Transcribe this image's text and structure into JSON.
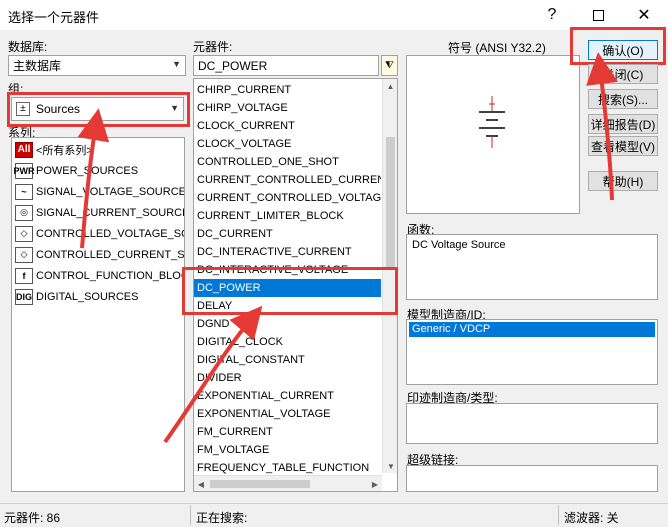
{
  "window": {
    "title": "选择一个元器件"
  },
  "database": {
    "label": "数据库:",
    "value": "主数据库"
  },
  "group": {
    "label": "组:",
    "value": "Sources"
  },
  "series": {
    "label": "系列:",
    "items": [
      {
        "icon": "All",
        "label": "<所有系列>"
      },
      {
        "icon": "PWR",
        "label": "POWER_SOURCES"
      },
      {
        "icon": "~",
        "label": "SIGNAL_VOLTAGE_SOURCES"
      },
      {
        "icon": "◎",
        "label": "SIGNAL_CURRENT_SOURCES"
      },
      {
        "icon": "◇",
        "label": "CONTROLLED_VOLTAGE_SOUR"
      },
      {
        "icon": "◇",
        "label": "CONTROLLED_CURRENT_SOUI"
      },
      {
        "icon": "f",
        "label": "CONTROL_FUNCTION_BLOCKS"
      },
      {
        "icon": "DIG",
        "label": "DIGITAL_SOURCES"
      }
    ]
  },
  "component": {
    "label": "元器件:",
    "search_value": "DC_POWER",
    "items": [
      "CHIRP_CURRENT",
      "CHIRP_VOLTAGE",
      "CLOCK_CURRENT",
      "CLOCK_VOLTAGE",
      "CONTROLLED_ONE_SHOT",
      "CURRENT_CONTROLLED_CURRENT_S",
      "CURRENT_CONTROLLED_VOLTAGE_SO",
      "CURRENT_LIMITER_BLOCK",
      "DC_CURRENT",
      "DC_INTERACTIVE_CURRENT",
      "DC_INTERACTIVE_VOLTAGE",
      "DC_POWER",
      "DELAY",
      "DGND",
      "DIGITAL_CLOCK",
      "DIGITAL_CONSTANT",
      "DIVIDER",
      "EXPONENTIAL_CURRENT",
      "EXPONENTIAL_VOLTAGE",
      "FM_CURRENT",
      "FM_VOLTAGE",
      "FREQUENCY_TABLE_FUNCTION"
    ],
    "selected": "DC_POWER"
  },
  "symbol": {
    "label": "符号 (ANSI Y32.2)"
  },
  "function": {
    "label": "函数:",
    "value": "DC Voltage Source"
  },
  "model": {
    "label": "模型制造商/ID:",
    "items": [
      "Generic / VDCP"
    ]
  },
  "footprint": {
    "label": "印迹制造商/类型:"
  },
  "hyperlink": {
    "label": "超级链接:"
  },
  "buttons": {
    "ok": "确认(O)",
    "close": "关闭(C)",
    "search": "搜索(S)...",
    "detail": "详细报告(D)",
    "view_model": "查看模型(V)",
    "help": "帮助(H)"
  },
  "status": {
    "count": "元器件:  86",
    "searching": "正在搜索:",
    "filter": "滤波器: 关"
  },
  "colors": {
    "highlight": "#e53935",
    "selection": "#0078d7"
  }
}
